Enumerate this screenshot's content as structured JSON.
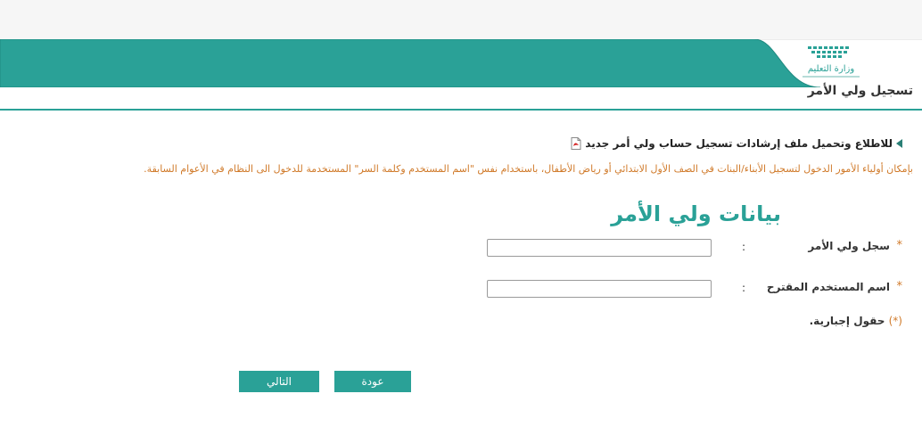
{
  "header": {
    "logo_text": "وزارة التعليم",
    "brand_color": "#2aa197"
  },
  "page": {
    "title": "تسجيل ولي الأمر"
  },
  "guide": {
    "link_text": "للاطلاع وتحميل ملف إرشادات تسجيل حساب ولي أمر جديد",
    "icon": "pdf-icon"
  },
  "notice": {
    "text": "بإمكان أولياء الأمور الدخول لتسجيل الأبناء/البنات في الصف الأول الابتدائي أو رياض الأطفال، باستخدام نفس \"اسم المستخدم وكلمة السر\" المستخدمة للدخول الى النظام في الأعوام السابقة.",
    "color": "#d07a2a"
  },
  "form": {
    "heading": "بيانات ولي الأمر",
    "required_mark": "*",
    "colon": ":",
    "fields": [
      {
        "label": "سجل ولي الأمر",
        "value": ""
      },
      {
        "label": "اسم المستخدم المقترح",
        "value": ""
      }
    ],
    "required_note_mark": "(*)",
    "required_note_text": "حقول إجبارية."
  },
  "buttons": {
    "back": "عودة",
    "next": "التالي"
  }
}
